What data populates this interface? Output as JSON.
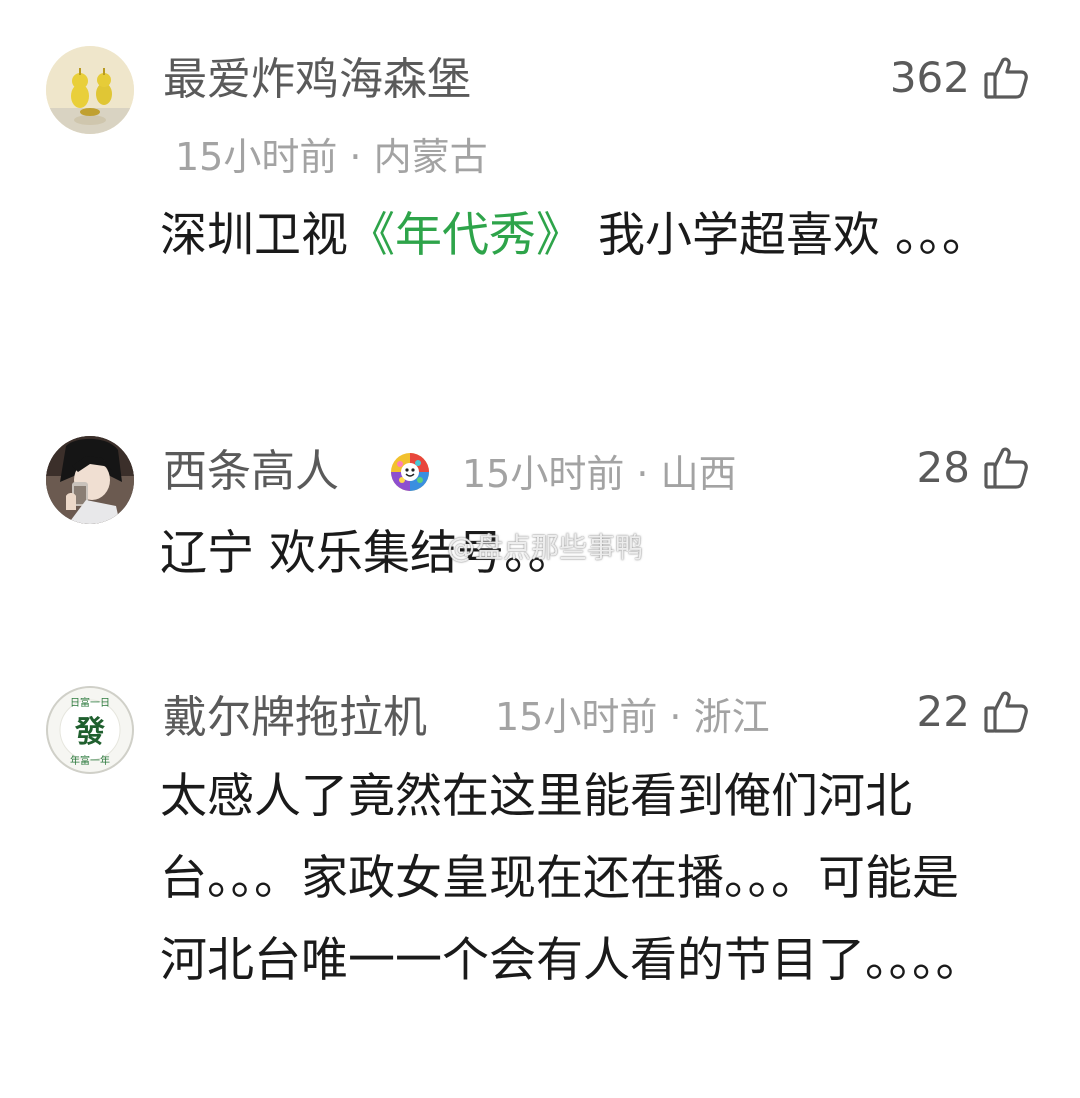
{
  "comments": [
    {
      "username": "最爱炸鸡海森堡",
      "meta": "15小时前 · 内蒙古",
      "likes": "362",
      "body_pre": "深圳卫视",
      "body_link": "《年代秀》",
      "body_post": " 我小学超喜欢 。。。"
    },
    {
      "username": "西条高人",
      "meta": "15小时前 · 山西",
      "likes": "28",
      "body": "辽宁 欢乐集结号。。"
    },
    {
      "username": "戴尔牌拖拉机",
      "meta": "15小时前 · 浙江",
      "likes": "22",
      "body": "太感人了竟然在这里能看到俺们河北台。。。家政女皇现在还在播。。。可能是河北台唯一一个会有人看的节目了。。。。",
      "avatar_text": "發"
    }
  ],
  "watermark": "@盘点那些事鸭",
  "colors": {
    "link_green": "#2ea44a",
    "username_gray": "#5a5a5a",
    "meta_gray": "#a3a3a3"
  },
  "icons": {
    "like": "thumbs-up-icon"
  }
}
